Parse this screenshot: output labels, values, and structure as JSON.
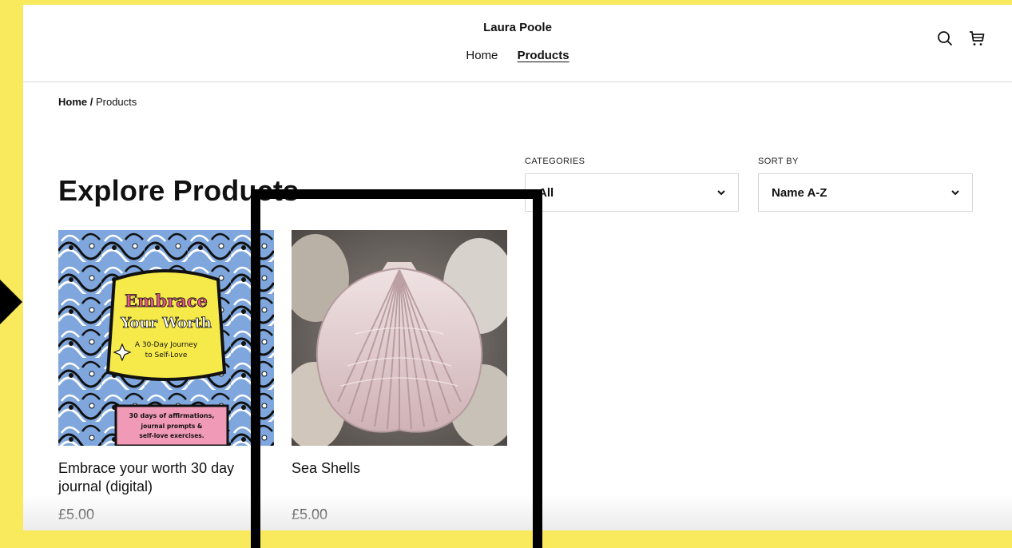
{
  "header": {
    "site_title": "Laura Poole",
    "nav": [
      {
        "label": "Home",
        "active": false
      },
      {
        "label": "Products",
        "active": true
      }
    ],
    "icons": [
      "search-icon",
      "cart-icon"
    ]
  },
  "breadcrumb": {
    "home": "Home /",
    "current": "Products"
  },
  "main": {
    "title": "Explore Products"
  },
  "filters": {
    "categories": {
      "label": "CATEGORIES",
      "value": "All"
    },
    "sort": {
      "label": "SORT BY",
      "value": "Name A-Z"
    }
  },
  "products": [
    {
      "name": "Embrace your worth 30 day journal (digital)",
      "price": "£5.00",
      "image": {
        "title_line1": "Embrace",
        "title_line2": "Your Worth",
        "subtitle_line1": "A 30-Day Journey",
        "subtitle_line2": "to Self-Love",
        "footer_line1": "30 days of affirmations,",
        "footer_line2": "journal prompts &",
        "footer_line3": "self-love exercises."
      }
    },
    {
      "name": "Sea Shells",
      "price": "£5.00"
    }
  ],
  "colors": {
    "background": "#f8ea5c",
    "highlight": "#000000",
    "journal_yellow": "#f6ea4a",
    "journal_blue": "#7fa7dd",
    "journal_pink": "#f19ab8"
  }
}
